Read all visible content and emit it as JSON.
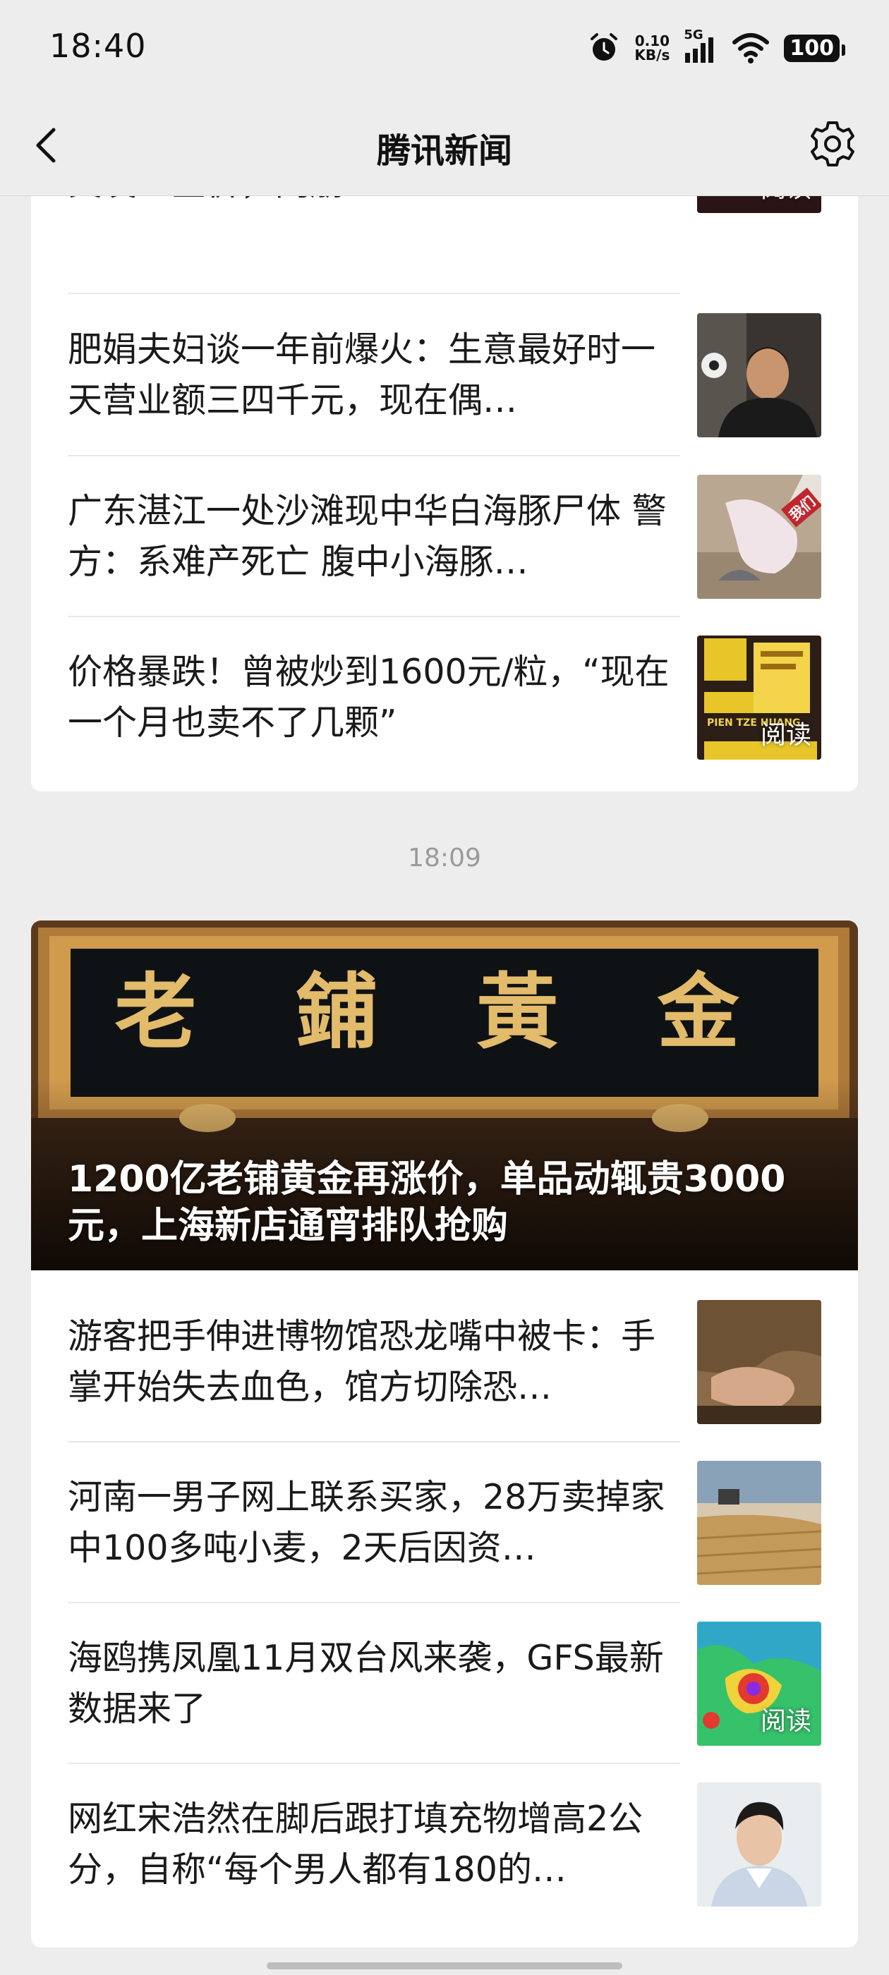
{
  "status_bar": {
    "time": "18:40",
    "net_speed_value": "0.10",
    "net_speed_unit": "KB/s",
    "signal_label": "5G",
    "battery": "100",
    "icons": [
      "alarm-icon",
      "signal-icon",
      "wifi-icon",
      "battery-icon"
    ]
  },
  "nav": {
    "title": "腾讯新闻",
    "back_icon": "chevron-left-icon",
    "settings_icon": "gear-icon"
  },
  "group1": {
    "items": [
      {
        "title": "突发！金价，闪崩",
        "thumb_label": "阅读"
      },
      {
        "title": "肥娟夫妇谈一年前爆火：生意最好时一天营业额三四千元，现在偶…"
      },
      {
        "title": "广东湛江一处沙滩现中华白海豚尸体 警方：系难产死亡 腹中小海豚…",
        "thumb_badge": "我们"
      },
      {
        "title": "价格暴跌！曾被炒到1600元/粒，“现在一个月也卖不了几颗”",
        "thumb_label": "阅读",
        "thumb_text": "PIEN TZE HUANG"
      }
    ]
  },
  "timestamp": "18:09",
  "group2": {
    "hero": {
      "sign_text": "老 鋪 黃 金",
      "title": "1200亿老铺黄金再涨价，单品动辄贵3000元，上海新店通宵排队抢购"
    },
    "items": [
      {
        "title": "游客把手伸进博物馆恐龙嘴中被卡：手掌开始失去血色，馆方切除恐…"
      },
      {
        "title": "河南一男子网上联系买家，28万卖掉家中100多吨小麦，2天后因资…"
      },
      {
        "title": "海鸥携凤凰11月双台风来袭，GFS最新数据来了",
        "thumb_label": "阅读"
      },
      {
        "title": "网红宋浩然在脚后跟打填充物增高2公分，自称“每个男人都有180的…"
      }
    ]
  }
}
